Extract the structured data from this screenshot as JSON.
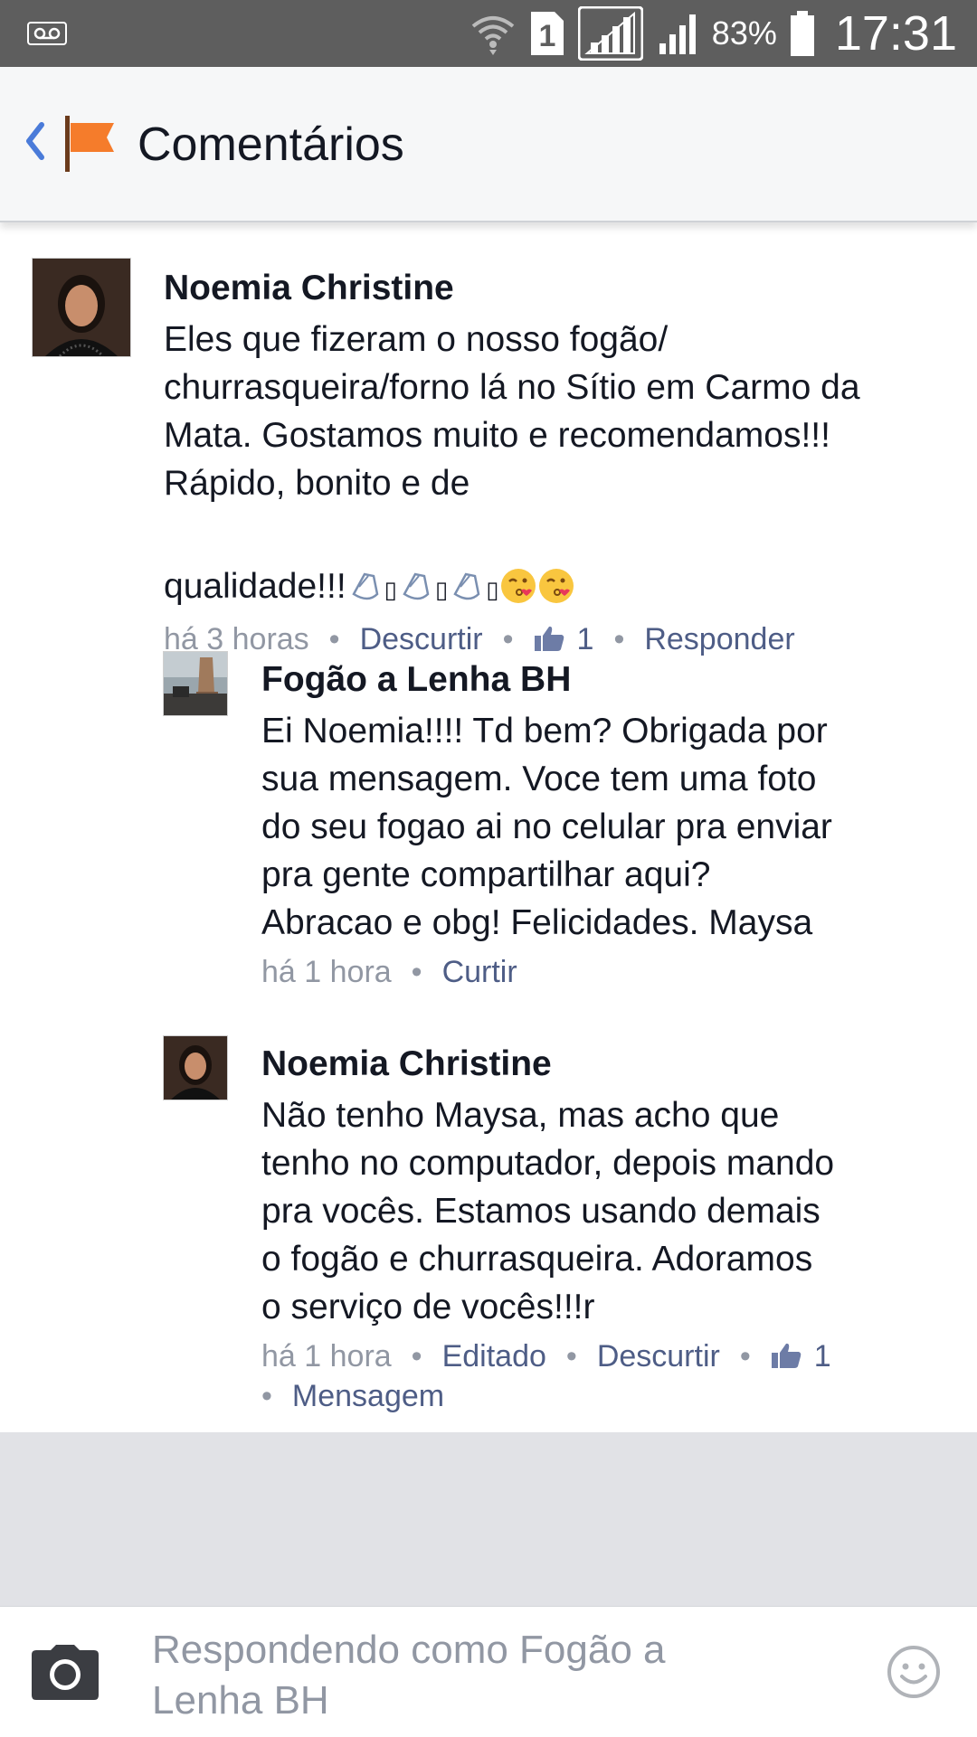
{
  "status_bar": {
    "battery_percent": "83%",
    "time": "17:31",
    "sim_slot": "1",
    "icons": [
      "voicemail-icon",
      "wifi-icon",
      "sim-1-icon",
      "signal-icon",
      "signal-2-icon",
      "battery-icon"
    ]
  },
  "header": {
    "title": "Comentários",
    "back_icon": "chevron-left-icon",
    "page_icon": "flag-icon",
    "flag_color": "#f57c2b"
  },
  "comments": [
    {
      "author": "Noemia Christine",
      "text": "Eles que fizeram o nosso fogão/\nchurrasqueira/forno lá no Sítio em Carmo da\nMata. Gostamos muito e recomendamos!!!\nRápido, bonito e de",
      "text_tail": "qualidade!!!",
      "emojis": [
        "clapping-hands-icon",
        "clapping-hands-icon",
        "clapping-hands-icon",
        "kissing-face-icon",
        "kissing-face-icon"
      ],
      "time": "há 3 horas",
      "actions": [
        "Descurtir"
      ],
      "like_count": "1",
      "reply": "Responder"
    },
    {
      "author": "Fogão a Lenha BH",
      "text": "Ei Noemia!!!! Td bem? Obrigada por\nsua mensagem. Voce tem uma foto\ndo seu fogao ai no celular pra enviar\npra gente compartilhar aqui?\nAbracao e obg! Felicidades. Maysa",
      "time": "há 1 hora",
      "actions": [
        "Curtir"
      ]
    },
    {
      "author": "Noemia Christine",
      "text": "Não tenho Maysa, mas acho que\ntenho no computador, depois mando\npra vocês. Estamos usando demais\no fogão e churrasqueira. Adoramos\no serviço de vocês!!!r",
      "time": "há 1 hora",
      "actions": [
        "Editado",
        "Descurtir"
      ],
      "like_count": "1",
      "message": "Mensagem"
    }
  ],
  "composer": {
    "placeholder": "Respondendo como Fogão a\nLenha BH",
    "camera_icon": "camera-icon",
    "emoji_icon": "smiley-icon"
  },
  "colors": {
    "link": "#4e5d86",
    "meta": "#9197a3",
    "status_bar": "#5e5e5e",
    "header_bg": "#f6f7f8",
    "back_chevron": "#4a7bd9"
  }
}
